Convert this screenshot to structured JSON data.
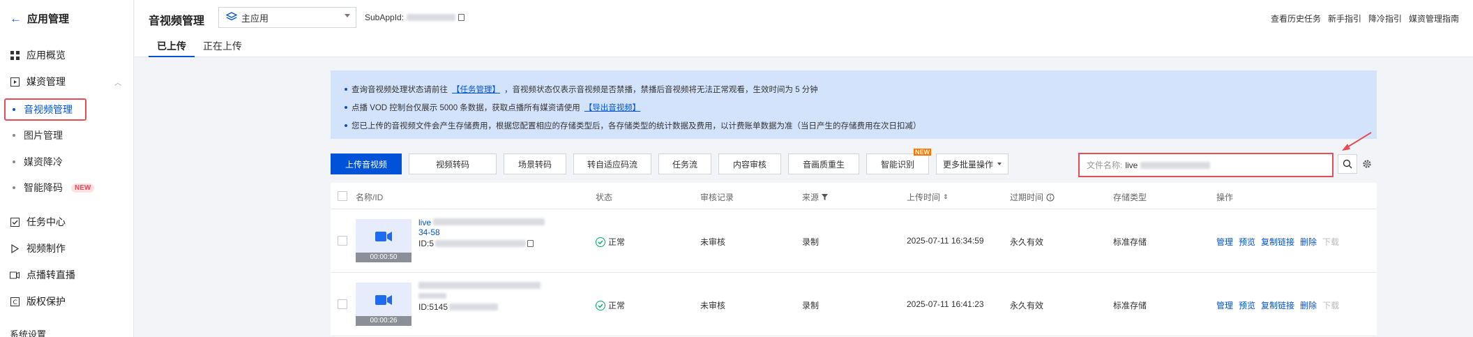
{
  "sidebar": {
    "title": "应用管理",
    "items": [
      {
        "label": "应用概览",
        "icon": "grid-icon"
      },
      {
        "label": "媒资管理",
        "icon": "play-square-icon"
      },
      {
        "label": "音视频管理"
      },
      {
        "label": "图片管理"
      },
      {
        "label": "媒资降冷"
      },
      {
        "label": "智能降码",
        "badge": "NEW"
      },
      {
        "label": "任务中心",
        "icon": "check-square-icon"
      },
      {
        "label": "视频制作",
        "icon": "play-icon"
      },
      {
        "label": "点播转直播",
        "icon": "broadcast-icon"
      },
      {
        "label": "版权保护",
        "icon": "copyright-icon"
      },
      {
        "label": "系统设置"
      }
    ]
  },
  "header": {
    "title": "音视频管理",
    "app_select": "主应用",
    "subapp_label": "SubAppId:",
    "links": [
      "查看历史任务",
      "新手指引",
      "降冷指引",
      "媒资管理指南"
    ],
    "tabs": [
      "已上传",
      "正在上传"
    ]
  },
  "notice": {
    "line1_pre": "查询音视频处理状态请前往",
    "line1_link": "【任务管理】",
    "line1_post": "，音视频状态仅表示音视频是否禁播，禁播后音视频将无法正常观看，生效时间为 5 分钟",
    "line2_pre": "点播 VOD 控制台仅展示 5000 条数据，获取点播所有媒资请使用",
    "line2_link": "【导出音视频】",
    "line3": "您已上传的音视频文件会产生存储费用，根据您配置相应的存储类型后，各存储类型的统计数据及费用，以计费账单数据为准（当日产生的存储费用在次日扣减）"
  },
  "toolbar": {
    "upload": "上传音视频",
    "buttons": [
      "视频转码",
      "场景转码",
      "转自适应码流",
      "任务流",
      "内容审核",
      "音画质重生",
      "智能识别"
    ],
    "new_badge": "NEW",
    "more": "更多批量操作"
  },
  "search": {
    "label": "文件名称:",
    "value": "live"
  },
  "table": {
    "columns": [
      "名称/ID",
      "状态",
      "审核记录",
      "来源",
      "上传时间",
      "过期时间",
      "存储类型",
      "操作"
    ],
    "rows": [
      {
        "name_prefix": "live",
        "name_line2": "34-58",
        "id_prefix": "ID:5",
        "duration": "00:00:50",
        "status": "正常",
        "review": "未审核",
        "source": "录制",
        "upload_time": "2025-07-11 16:34:59",
        "expire": "永久有效",
        "storage": "标准存储"
      },
      {
        "name_prefix": "",
        "name_line2": "",
        "id_prefix": "ID:5145",
        "duration": "00:00:26",
        "status": "正常",
        "review": "未审核",
        "source": "录制",
        "upload_time": "2025-07-11 16:41:23",
        "expire": "永久有效",
        "storage": "标准存储"
      }
    ],
    "ops": [
      "管理",
      "预览",
      "复制链接",
      "删除",
      "下载"
    ]
  },
  "colors": {
    "primary": "#0052d9",
    "highlight": "#e34d59",
    "notice_bg": "#d4e3fc",
    "success": "#00a870"
  }
}
